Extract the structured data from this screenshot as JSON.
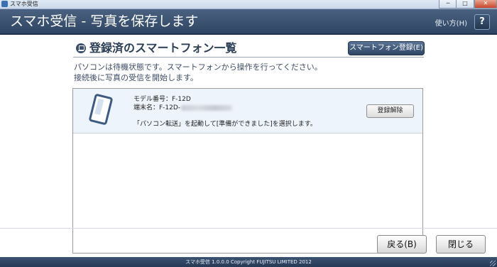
{
  "window": {
    "title": "スマホ受信",
    "minimize_glyph": "─",
    "maximize_glyph": "□",
    "close_glyph": "✕"
  },
  "header": {
    "title": "スマホ受信 - 写真を保存します",
    "help_link": "使い方(H)",
    "help_button": "?"
  },
  "section": {
    "title": "登録済のスマートフォン一覧",
    "icon": "laptop-icon",
    "register_button": "スマートフォン登録(E)"
  },
  "info": {
    "line1": "パソコンは待機状態です。スマートフォンから操作を行ってください。",
    "line2": "接続後に写真の受信を開始します。"
  },
  "devices": [
    {
      "model": "モデル番号：F-12D",
      "terminal_prefix": "端末名：F-12D-",
      "instruction": "「パソコン転送」を起動して[準備ができました]を選択します。",
      "unregister_button": "登録解除",
      "icon": "smartphone-icon"
    }
  ],
  "buttons": {
    "back": "戻る(B)",
    "close": "閉じる"
  },
  "footer": {
    "text": "スマホ受信 1.0.0.0 Copyright FUJITSU LIMITED 2012"
  },
  "colors": {
    "header_bg": "#2e4563",
    "accent": "#3d5a80",
    "row_highlight": "#eef4fb"
  }
}
